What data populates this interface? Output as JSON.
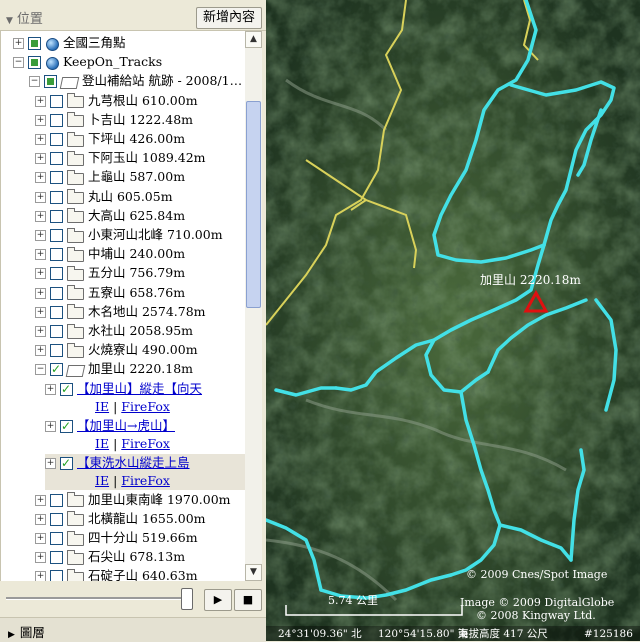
{
  "panel": {
    "title": "位置",
    "add_button": "新增內容"
  },
  "tree": {
    "items": [
      {
        "label": "全國三角點",
        "level": 1,
        "expander": "+",
        "check": "part",
        "icon": "globe"
      },
      {
        "label": "KeepOn_Tracks",
        "level": 1,
        "expander": "−",
        "check": "part",
        "icon": "globe"
      },
      {
        "label": "登山補給站 航跡 - 2008/1…",
        "level": 2,
        "expander": "−",
        "check": "part",
        "icon": "folder-open"
      },
      {
        "label": "九芎根山 610.00m",
        "level": 3,
        "expander": "+",
        "check": "off",
        "icon": "folder"
      },
      {
        "label": "卜吉山 1222.48m",
        "level": 3,
        "expander": "+",
        "check": "off",
        "icon": "folder"
      },
      {
        "label": "下坪山 426.00m",
        "level": 3,
        "expander": "+",
        "check": "off",
        "icon": "folder"
      },
      {
        "label": "下阿玉山 1089.42m",
        "level": 3,
        "expander": "+",
        "check": "off",
        "icon": "folder"
      },
      {
        "label": "上龜山 587.00m",
        "level": 3,
        "expander": "+",
        "check": "off",
        "icon": "folder"
      },
      {
        "label": "丸山 605.05m",
        "level": 3,
        "expander": "+",
        "check": "off",
        "icon": "folder"
      },
      {
        "label": "大高山 625.84m",
        "level": 3,
        "expander": "+",
        "check": "off",
        "icon": "folder"
      },
      {
        "label": "小東河山北峰 710.00m",
        "level": 3,
        "expander": "+",
        "check": "off",
        "icon": "folder"
      },
      {
        "label": "中埔山 240.00m",
        "level": 3,
        "expander": "+",
        "check": "off",
        "icon": "folder"
      },
      {
        "label": "五分山 756.79m",
        "level": 3,
        "expander": "+",
        "check": "off",
        "icon": "folder"
      },
      {
        "label": "五寮山 658.76m",
        "level": 3,
        "expander": "+",
        "check": "off",
        "icon": "folder"
      },
      {
        "label": "木名地山 2574.78m",
        "level": 3,
        "expander": "+",
        "check": "off",
        "icon": "folder"
      },
      {
        "label": "水社山 2058.95m",
        "level": 3,
        "expander": "+",
        "check": "off",
        "icon": "folder"
      },
      {
        "label": "火燒寮山 490.00m",
        "level": 3,
        "expander": "+",
        "check": "off",
        "icon": "folder"
      },
      {
        "label": "加里山 2220.18m",
        "level": 3,
        "expander": "−",
        "check": "on",
        "icon": "folder-open"
      }
    ],
    "tracks": [
      {
        "title": "【加里山】縱走【向天",
        "ie": "IE",
        "sep": "|",
        "ff": "FireFox"
      },
      {
        "title": "【加里山→虎山】",
        "ie": "IE",
        "sep": "|",
        "ff": "FireFox"
      },
      {
        "title": "【東洗水山縱走上島",
        "ie": "IE",
        "sep": "|",
        "ff": "FireFox"
      }
    ],
    "items_after": [
      {
        "label": "加里山東南峰 1970.00m",
        "expander": "+",
        "check": "off",
        "icon": "folder"
      },
      {
        "label": "北橫龍山 1655.00m",
        "expander": "+",
        "check": "off",
        "icon": "folder"
      },
      {
        "label": "四十分山 519.66m",
        "expander": "+",
        "check": "off",
        "icon": "folder"
      },
      {
        "label": "石尖山 678.13m",
        "expander": "+",
        "check": "off",
        "icon": "folder"
      },
      {
        "label": "石碇子山 640.63m",
        "expander": "+",
        "check": "off",
        "icon": "folder"
      }
    ]
  },
  "layers": {
    "label": "圖層"
  },
  "map": {
    "placemark": "加里山 2220.18m",
    "scale": "5.74 公里",
    "copyright_1": "© 2009 Cnes/Spot Image",
    "copyright_2": "Image © 2009 DigitalGlobe",
    "copyright_3": "© 2008 Kingway Ltd.",
    "lat": "24°31'09.36\" 北",
    "lon": "120°54'15.80\" 東",
    "elev": "海拔高度  417 公尺",
    "id": "#125186",
    "colors": {
      "track": "#43e0e6",
      "border": "#d8d15a",
      "marker": "#e01010"
    }
  }
}
